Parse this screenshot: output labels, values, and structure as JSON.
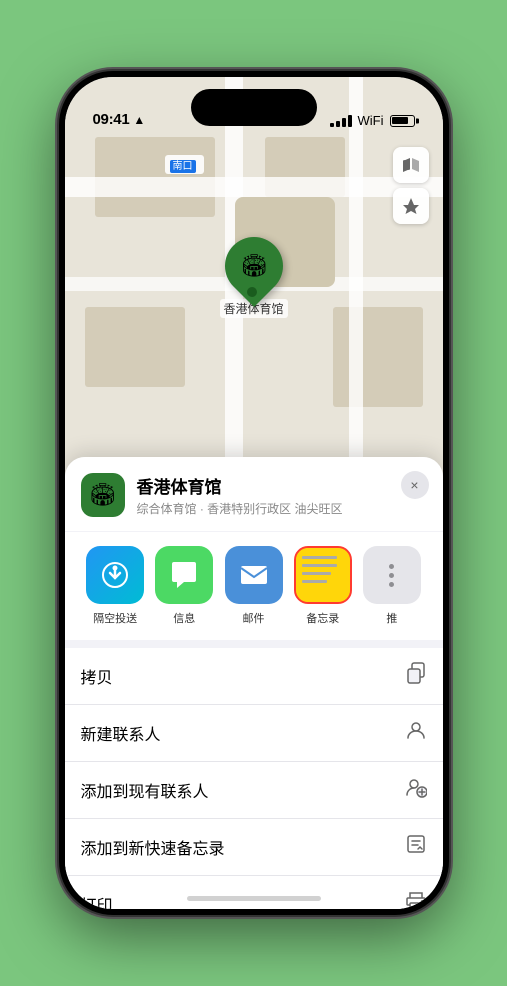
{
  "statusBar": {
    "time": "09:41",
    "timeIcon": "location-arrow"
  },
  "mapLabel": "南口",
  "mapControls": {
    "mapViewBtn": "🗺",
    "locationBtn": "➤"
  },
  "locationMarker": {
    "label": "香港体育馆",
    "emoji": "🏟"
  },
  "venueHeader": {
    "name": "香港体育馆",
    "description": "综合体育馆 · 香港特别行政区 油尖旺区",
    "closeLabel": "×"
  },
  "shareApps": [
    {
      "id": "airdrop",
      "label": "隔空投送",
      "icon": "📡"
    },
    {
      "id": "messages",
      "label": "信息",
      "icon": "💬"
    },
    {
      "id": "mail",
      "label": "邮件",
      "icon": "✉️"
    },
    {
      "id": "notes",
      "label": "备忘录",
      "icon": ""
    },
    {
      "id": "more",
      "label": "推",
      "icon": "···"
    }
  ],
  "actions": [
    {
      "id": "copy",
      "label": "拷贝",
      "icon": "⊡"
    },
    {
      "id": "new-contact",
      "label": "新建联系人",
      "icon": "👤"
    },
    {
      "id": "add-existing",
      "label": "添加到现有联系人",
      "icon": "👤+"
    },
    {
      "id": "add-quick-note",
      "label": "添加到新快速备忘录",
      "icon": "📋"
    },
    {
      "id": "print",
      "label": "打印",
      "icon": "🖨"
    }
  ]
}
